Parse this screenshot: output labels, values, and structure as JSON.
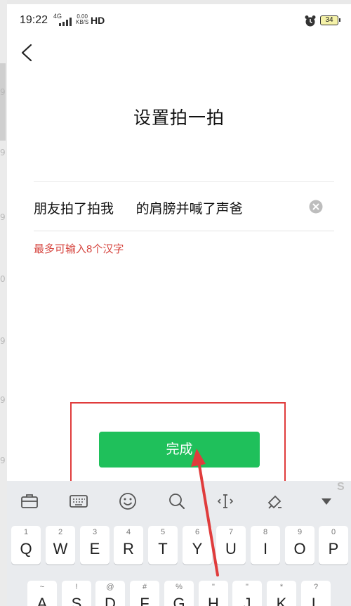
{
  "status_bar": {
    "time": "19:22",
    "network": "4G",
    "speed_value": "0.00",
    "speed_unit": "KB/S",
    "hd": "HD",
    "battery": "34"
  },
  "left_strip_glyphs": [
    "9",
    "9",
    "9",
    "0",
    "9",
    "9",
    "9"
  ],
  "header": {
    "title": "设置拍一拍"
  },
  "pat_input": {
    "value": "朋友拍了拍我      的肩膀并喊了声爸"
  },
  "hint": "最多可输入8个汉字",
  "done_button": "完成",
  "watermark": "S",
  "keyboard": {
    "toolbar_icons": [
      "toolbox-icon",
      "keyboard-icon",
      "emoji-icon",
      "search-icon",
      "cursor-icon",
      "clear-format-icon",
      "collapse-icon"
    ],
    "row1": [
      {
        "hint": "1",
        "key": "Q"
      },
      {
        "hint": "2",
        "key": "W"
      },
      {
        "hint": "3",
        "key": "E"
      },
      {
        "hint": "4",
        "key": "R"
      },
      {
        "hint": "5",
        "key": "T"
      },
      {
        "hint": "6",
        "key": "Y"
      },
      {
        "hint": "7",
        "key": "U"
      },
      {
        "hint": "8",
        "key": "I"
      },
      {
        "hint": "9",
        "key": "O"
      },
      {
        "hint": "0",
        "key": "P"
      }
    ],
    "row2": [
      {
        "hint": "~",
        "key": "A"
      },
      {
        "hint": "!",
        "key": "S"
      },
      {
        "hint": "@",
        "key": "D"
      },
      {
        "hint": "#",
        "key": "F"
      },
      {
        "hint": "%",
        "key": "G"
      },
      {
        "hint": "\"",
        "key": "H"
      },
      {
        "hint": "\"",
        "key": "J"
      },
      {
        "hint": "*",
        "key": "K"
      },
      {
        "hint": "?",
        "key": "L"
      }
    ]
  },
  "colors": {
    "accent_green": "#1fc05b",
    "hint_red": "#d6453f",
    "annotation_red": "#e03c3c"
  }
}
